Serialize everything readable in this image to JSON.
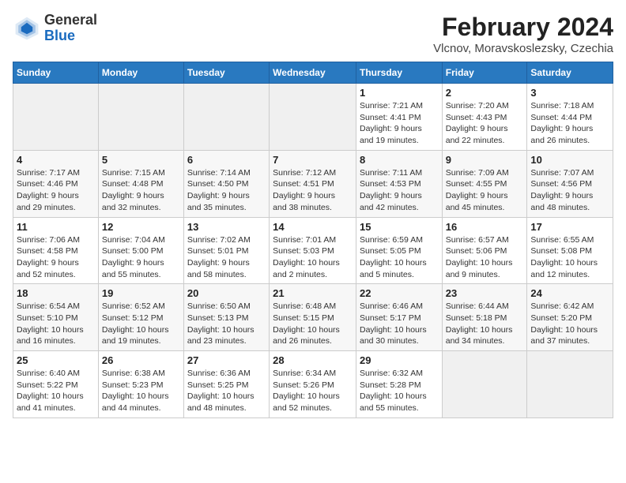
{
  "header": {
    "logo_general": "General",
    "logo_blue": "Blue",
    "title": "February 2024",
    "subtitle": "Vlcnov, Moravskoslezsky, Czechia"
  },
  "weekdays": [
    "Sunday",
    "Monday",
    "Tuesday",
    "Wednesday",
    "Thursday",
    "Friday",
    "Saturday"
  ],
  "weeks": [
    [
      {
        "day": "",
        "detail": ""
      },
      {
        "day": "",
        "detail": ""
      },
      {
        "day": "",
        "detail": ""
      },
      {
        "day": "",
        "detail": ""
      },
      {
        "day": "1",
        "detail": "Sunrise: 7:21 AM\nSunset: 4:41 PM\nDaylight: 9 hours\nand 19 minutes."
      },
      {
        "day": "2",
        "detail": "Sunrise: 7:20 AM\nSunset: 4:43 PM\nDaylight: 9 hours\nand 22 minutes."
      },
      {
        "day": "3",
        "detail": "Sunrise: 7:18 AM\nSunset: 4:44 PM\nDaylight: 9 hours\nand 26 minutes."
      }
    ],
    [
      {
        "day": "4",
        "detail": "Sunrise: 7:17 AM\nSunset: 4:46 PM\nDaylight: 9 hours\nand 29 minutes."
      },
      {
        "day": "5",
        "detail": "Sunrise: 7:15 AM\nSunset: 4:48 PM\nDaylight: 9 hours\nand 32 minutes."
      },
      {
        "day": "6",
        "detail": "Sunrise: 7:14 AM\nSunset: 4:50 PM\nDaylight: 9 hours\nand 35 minutes."
      },
      {
        "day": "7",
        "detail": "Sunrise: 7:12 AM\nSunset: 4:51 PM\nDaylight: 9 hours\nand 38 minutes."
      },
      {
        "day": "8",
        "detail": "Sunrise: 7:11 AM\nSunset: 4:53 PM\nDaylight: 9 hours\nand 42 minutes."
      },
      {
        "day": "9",
        "detail": "Sunrise: 7:09 AM\nSunset: 4:55 PM\nDaylight: 9 hours\nand 45 minutes."
      },
      {
        "day": "10",
        "detail": "Sunrise: 7:07 AM\nSunset: 4:56 PM\nDaylight: 9 hours\nand 48 minutes."
      }
    ],
    [
      {
        "day": "11",
        "detail": "Sunrise: 7:06 AM\nSunset: 4:58 PM\nDaylight: 9 hours\nand 52 minutes."
      },
      {
        "day": "12",
        "detail": "Sunrise: 7:04 AM\nSunset: 5:00 PM\nDaylight: 9 hours\nand 55 minutes."
      },
      {
        "day": "13",
        "detail": "Sunrise: 7:02 AM\nSunset: 5:01 PM\nDaylight: 9 hours\nand 58 minutes."
      },
      {
        "day": "14",
        "detail": "Sunrise: 7:01 AM\nSunset: 5:03 PM\nDaylight: 10 hours\nand 2 minutes."
      },
      {
        "day": "15",
        "detail": "Sunrise: 6:59 AM\nSunset: 5:05 PM\nDaylight: 10 hours\nand 5 minutes."
      },
      {
        "day": "16",
        "detail": "Sunrise: 6:57 AM\nSunset: 5:06 PM\nDaylight: 10 hours\nand 9 minutes."
      },
      {
        "day": "17",
        "detail": "Sunrise: 6:55 AM\nSunset: 5:08 PM\nDaylight: 10 hours\nand 12 minutes."
      }
    ],
    [
      {
        "day": "18",
        "detail": "Sunrise: 6:54 AM\nSunset: 5:10 PM\nDaylight: 10 hours\nand 16 minutes."
      },
      {
        "day": "19",
        "detail": "Sunrise: 6:52 AM\nSunset: 5:12 PM\nDaylight: 10 hours\nand 19 minutes."
      },
      {
        "day": "20",
        "detail": "Sunrise: 6:50 AM\nSunset: 5:13 PM\nDaylight: 10 hours\nand 23 minutes."
      },
      {
        "day": "21",
        "detail": "Sunrise: 6:48 AM\nSunset: 5:15 PM\nDaylight: 10 hours\nand 26 minutes."
      },
      {
        "day": "22",
        "detail": "Sunrise: 6:46 AM\nSunset: 5:17 PM\nDaylight: 10 hours\nand 30 minutes."
      },
      {
        "day": "23",
        "detail": "Sunrise: 6:44 AM\nSunset: 5:18 PM\nDaylight: 10 hours\nand 34 minutes."
      },
      {
        "day": "24",
        "detail": "Sunrise: 6:42 AM\nSunset: 5:20 PM\nDaylight: 10 hours\nand 37 minutes."
      }
    ],
    [
      {
        "day": "25",
        "detail": "Sunrise: 6:40 AM\nSunset: 5:22 PM\nDaylight: 10 hours\nand 41 minutes."
      },
      {
        "day": "26",
        "detail": "Sunrise: 6:38 AM\nSunset: 5:23 PM\nDaylight: 10 hours\nand 44 minutes."
      },
      {
        "day": "27",
        "detail": "Sunrise: 6:36 AM\nSunset: 5:25 PM\nDaylight: 10 hours\nand 48 minutes."
      },
      {
        "day": "28",
        "detail": "Sunrise: 6:34 AM\nSunset: 5:26 PM\nDaylight: 10 hours\nand 52 minutes."
      },
      {
        "day": "29",
        "detail": "Sunrise: 6:32 AM\nSunset: 5:28 PM\nDaylight: 10 hours\nand 55 minutes."
      },
      {
        "day": "",
        "detail": ""
      },
      {
        "day": "",
        "detail": ""
      }
    ]
  ]
}
